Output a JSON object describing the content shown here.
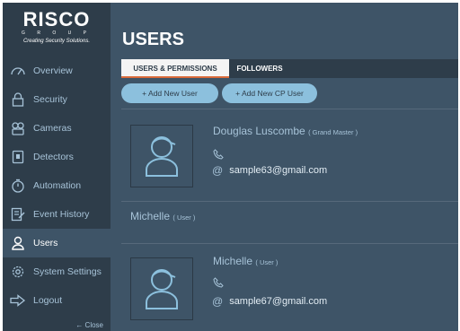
{
  "logo": {
    "brand": "RISCO",
    "group": "G R O U P",
    "tagline": "Creating Security Solutions."
  },
  "sidebar": {
    "items": [
      {
        "label": "Overview",
        "icon": "overview-icon"
      },
      {
        "label": "Security",
        "icon": "lock-icon"
      },
      {
        "label": "Cameras",
        "icon": "camera-icon"
      },
      {
        "label": "Detectors",
        "icon": "detector-icon"
      },
      {
        "label": "Automation",
        "icon": "automation-icon"
      },
      {
        "label": "Event History",
        "icon": "history-icon"
      },
      {
        "label": "Users",
        "icon": "user-icon",
        "active": true
      },
      {
        "label": "System Settings",
        "icon": "gear-icon"
      },
      {
        "label": "Logout",
        "icon": "logout-icon"
      }
    ],
    "close": "← Close"
  },
  "main": {
    "title": "USERS",
    "tabs": [
      {
        "label": "USERS & PERMISSIONS",
        "active": true
      },
      {
        "label": "FOLLOWERS",
        "active": false
      }
    ],
    "buttons": {
      "add_user": "+ Add New User",
      "add_cp_user": "+ Add New CP User"
    },
    "users": [
      {
        "name": "Douglas Luscombe",
        "role": "( Grand Master )",
        "email": "sample63@gmail.com"
      },
      {
        "name": "Michelle",
        "role": "( User )"
      },
      {
        "name": "Michelle",
        "role": "( User )",
        "email": "sample67@gmail.com"
      }
    ]
  },
  "colors": {
    "sidebar": "#2e3d4a",
    "main": "#3e5467",
    "accent": "#d96a3a",
    "button": "#8cc0dd",
    "text_link": "#a7c3d8"
  }
}
